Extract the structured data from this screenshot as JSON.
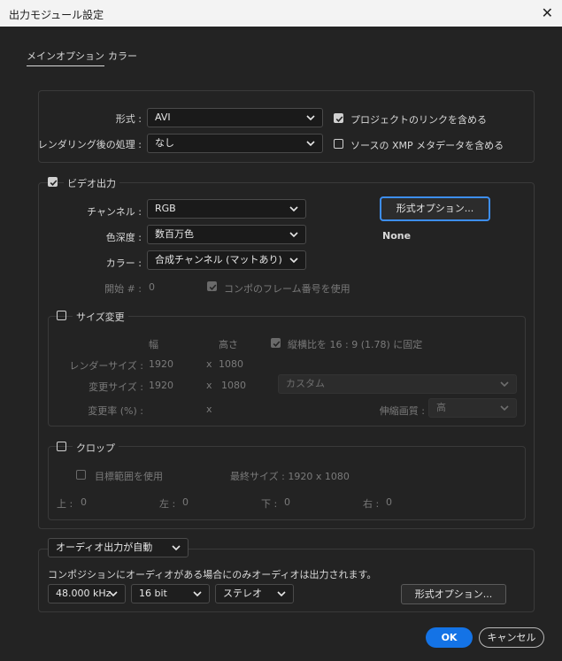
{
  "window": {
    "title": "出力モジュール設定",
    "close_glyph": "✕"
  },
  "tabs": [
    {
      "label": "メインオプション",
      "active": true
    },
    {
      "label": "カラー",
      "active": false
    }
  ],
  "format": {
    "label": "形式 :",
    "value": "AVI",
    "post_label": "レンダリング後の処理 :",
    "post_value": "なし",
    "include_project_link": "プロジェクトのリンクを含める",
    "include_project_link_checked": true,
    "include_xmp": "ソースの XMP メタデータを含める",
    "include_xmp_checked": false
  },
  "video": {
    "label": "ビデオ出力",
    "checked": true,
    "channel_label": "チャンネル :",
    "channel_value": "RGB",
    "depth_label": "色深度 :",
    "depth_value": "数百万色",
    "color_label": "カラー :",
    "color_value": "合成チャンネル (マットあり)",
    "start_label": "開始 # :",
    "start_value": "0",
    "use_comp_frame": "コンポのフレーム番号を使用",
    "use_comp_frame_checked": true,
    "format_options_button": "形式オプション...",
    "codec": "None"
  },
  "resize": {
    "label": "サイズ変更",
    "checked": false,
    "width_header": "幅",
    "height_header": "高さ",
    "lock_aspect": "縦横比を 16 : 9 (1.78) に固定",
    "lock_aspect_checked": true,
    "render_size_label": "レンダーサイズ :",
    "render_w": "1920",
    "render_h": "1080",
    "resize_to_label": "変更サイズ :",
    "resize_w": "1920",
    "resize_h": "1080",
    "preset": "カスタム",
    "resize_pct_label": "変更率 (%) :",
    "quality_label": "伸縮画質 :",
    "quality_value": "高",
    "times": "x"
  },
  "crop": {
    "label": "クロップ",
    "checked": false,
    "use_roi": "目標範囲を使用",
    "use_roi_checked": false,
    "final_size": "最終サイズ : 1920 x 1080",
    "top_label": "上 :",
    "top": "0",
    "left_label": "左 :",
    "left": "0",
    "bottom_label": "下 :",
    "bottom": "0",
    "right_label": "右 :",
    "right": "0"
  },
  "audio": {
    "mode": "オーディオ出力が自動",
    "note": "コンポジションにオーディオがある場合にのみオーディオは出力されます。",
    "rate": "48.000 kHz",
    "bits": "16 bit",
    "channels": "ステレオ",
    "format_options_button": "形式オプション..."
  },
  "footer": {
    "ok": "OK",
    "cancel": "キャンセル"
  },
  "colors": {
    "accent": "#1473e6",
    "focus_ring": "#3d8ef0",
    "background": "#232323"
  }
}
